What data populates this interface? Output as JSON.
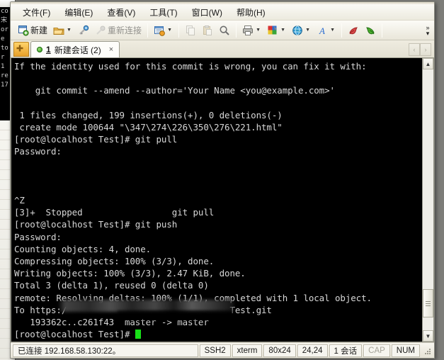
{
  "app": {
    "title": "SecureCRT"
  },
  "menubar": {
    "items": [
      {
        "label": "文件(F)",
        "name": "menu-file"
      },
      {
        "label": "编辑(E)",
        "name": "menu-edit"
      },
      {
        "label": "查看(V)",
        "name": "menu-view"
      },
      {
        "label": "工具(T)",
        "name": "menu-tools"
      },
      {
        "label": "窗口(W)",
        "name": "menu-window"
      },
      {
        "label": "帮助(H)",
        "name": "menu-help"
      }
    ]
  },
  "toolbar": {
    "new_label": "新建",
    "reconnect_label": "重新连接",
    "overflow_label": "»",
    "icons": {
      "new": "new-session-icon",
      "open": "open-folder-icon",
      "connect": "quick-connect-icon",
      "reconnect": "reconnect-icon",
      "log": "log-session-icon",
      "copy": "copy-icon",
      "paste": "paste-icon",
      "find": "find-icon",
      "print": "print-icon",
      "color": "color-scheme-icon",
      "globe": "web-icon",
      "font": "font-icon",
      "upload": "upload-icon",
      "download": "download-icon"
    }
  },
  "tabbar": {
    "new_tab_label": "+",
    "tabs": [
      {
        "index": "1",
        "label": "新建会话 (2)",
        "close": "×",
        "active": true,
        "connected": true
      }
    ],
    "scroll_left": "‹",
    "scroll_right": "›"
  },
  "terminal": {
    "columns": 80,
    "rows": 24,
    "background": "#000000",
    "foreground": "#d7d7d7",
    "cursor_color": "#18e018",
    "lines": [
      "If the identity used for this commit is wrong, you can fix it with:",
      "",
      "    git commit --amend --author='Your Name <you@example.com>'",
      "",
      " 1 files changed, 199 insertions(+), 0 deletions(-)",
      " create mode 100644 \"\\347\\274\\226\\350\\276\\221.html\"",
      "[root@localhost Test]# git pull",
      "Password:",
      "",
      "",
      "",
      "^Z",
      "[3]+  Stopped                 git pull",
      "[root@localhost Test]# git push",
      "Password:",
      "Counting objects: 4, done.",
      "Compressing objects: 100% (3/3), done.",
      "Writing objects: 100% (3/3), 2.47 KiB, done.",
      "Total 3 (delta 1), reused 0 (delta 0)",
      "remote: Resolving deltas: 100% (1/1), completed with 1 local object.",
      "To https:/                               Test.git",
      "   193362c..c261f43  master -> master",
      "[root@localhost Test]# "
    ],
    "scrollbar": {
      "up_arrow": "▲",
      "down_arrow": "▼"
    }
  },
  "statusbar": {
    "connection": "已连接 192.168.58.130:22。",
    "protocol": "SSH2",
    "emulation": "xterm",
    "size": "80x24",
    "cursor_pos": "24,24",
    "sessions": "1 会话",
    "caps": "CAP",
    "num": "NUM"
  },
  "background_window": {
    "terminal_fragment": "co\n宋\nor\ne\nto\nr\n1\nre\n17"
  }
}
